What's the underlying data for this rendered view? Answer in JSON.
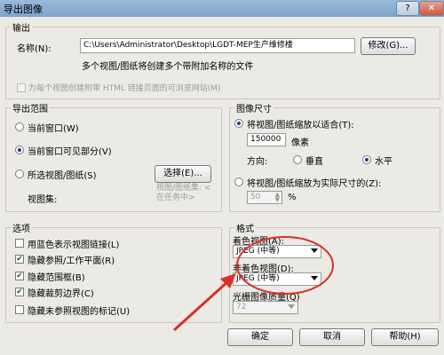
{
  "window": {
    "title": "导出图像"
  },
  "output": {
    "group_label": "输出",
    "name_label": "名称(N):",
    "name_value": "C:\\Users\\Administrator\\Desktop\\LGDT-MEP生产维修楼",
    "modify_button": "修改(G)...",
    "hint": "多个视图/图纸将创建多个带附加名称的文件",
    "html_checkbox_label": "为每个视图创建附带 HTML 链接页面的可浏览网站(M)"
  },
  "export_range": {
    "group_label": "导出范围",
    "current_window": "当前窗口(W)",
    "visible_part": "当前窗口可见部分(V)",
    "selected_views": "所选视图/图纸(S)",
    "select_button": "选择(E)...",
    "view_set_label": "视图集:",
    "view_set_value": "视图/图纸集: <在任务中>",
    "selected_option": "visible_part"
  },
  "image_size": {
    "group_label": "图像尺寸",
    "fit_label": "将视图/图纸缩放以适合(T):",
    "pixel_value": "150000",
    "pixel_unit": "像素",
    "direction_label": "方向:",
    "vertical": "垂直",
    "horizontal": "水平",
    "scale_label": "将视图/图纸缩放为实际尺寸的(Z):",
    "scale_value": "50",
    "scale_unit": "%"
  },
  "options": {
    "group_label": "选项",
    "items": [
      {
        "label": "用蓝色表示视图链接(L)",
        "checked": false
      },
      {
        "label": "隐藏参照/工作平面(R)",
        "checked": true
      },
      {
        "label": "隐藏范围框(B)",
        "checked": true
      },
      {
        "label": "隐藏裁剪边界(C)",
        "checked": true
      },
      {
        "label": "隐藏未参照视图的标记(U)",
        "checked": false
      }
    ]
  },
  "format": {
    "group_label": "格式",
    "shaded_label": "着色视图(A):",
    "shaded_value": "JPEG (中等)",
    "nonshaded_label": "非着色视图(D):",
    "nonshaded_value": "JPEG (中等)",
    "raster_label": "光栅图像质量(Q)",
    "raster_value": "72"
  },
  "buttons": {
    "ok": "确定",
    "cancel": "取消",
    "help": "帮助(H)"
  },
  "annotation_color": "#d9302a"
}
